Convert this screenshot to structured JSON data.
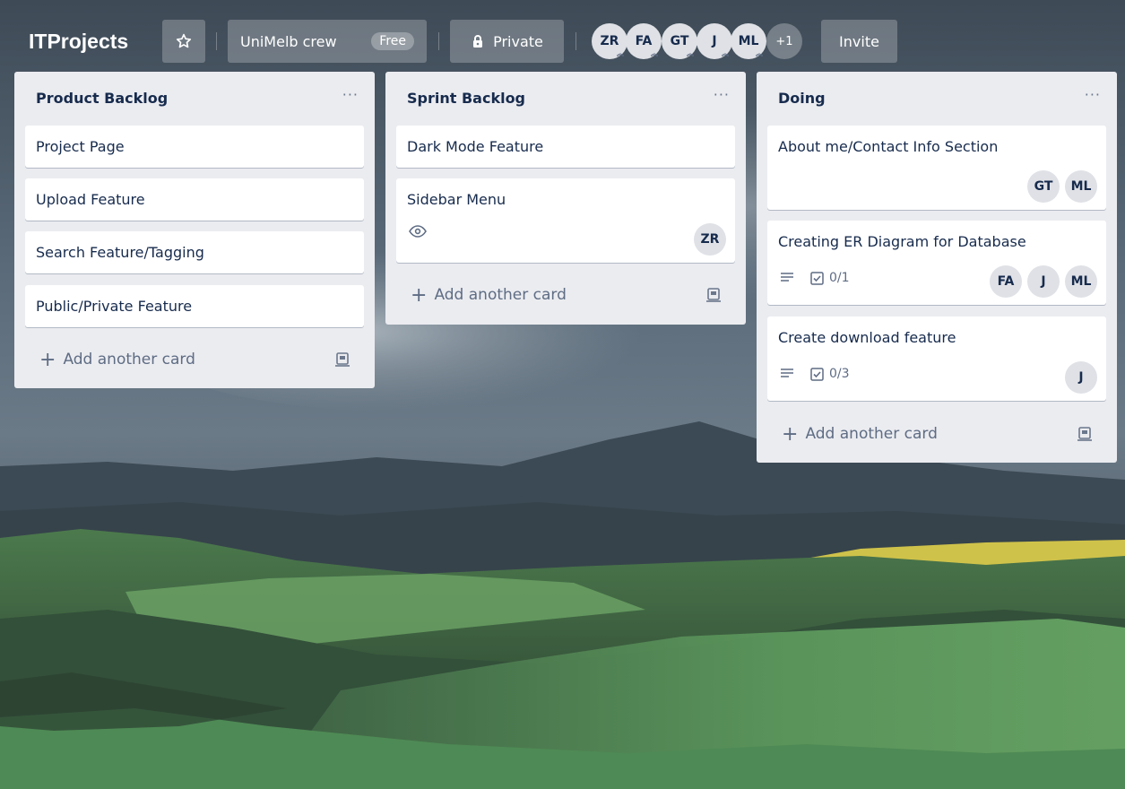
{
  "board": {
    "title": "ITProjects",
    "team_name": "UniMelb crew",
    "team_badge": "Free",
    "visibility": "Private",
    "invite_label": "Invite",
    "members": [
      "ZR",
      "FA",
      "GT",
      "J",
      "ML"
    ],
    "more_members": "+1"
  },
  "add_card_label": "Add another card",
  "menu_glyph": "···",
  "lists": [
    {
      "title": "Product Backlog",
      "cards": [
        {
          "title": "Project Page"
        },
        {
          "title": "Upload Feature"
        },
        {
          "title": "Search Feature/Tagging"
        },
        {
          "title": "Public/Private Feature"
        }
      ]
    },
    {
      "title": "Sprint Backlog",
      "cards": [
        {
          "title": "Dark Mode Feature"
        },
        {
          "title": "Sidebar Menu",
          "members": [
            "ZR"
          ]
        }
      ]
    },
    {
      "title": "Doing",
      "cards": [
        {
          "title": "About me/Contact Info Section",
          "members": [
            "GT",
            "ML"
          ]
        },
        {
          "title": "Creating ER Diagram for Database",
          "checklist": "0/1",
          "members": [
            "FA",
            "J",
            "ML"
          ]
        },
        {
          "title": "Create download feature",
          "checklist": "0/3",
          "members": [
            "J"
          ]
        }
      ]
    }
  ],
  "colors": {
    "list_bg": "#ebecf0",
    "card_bg": "#ffffff",
    "header_button": "rgba(255,255,255,0.24)",
    "text": "#172b4d",
    "muted": "#5e6c84"
  }
}
